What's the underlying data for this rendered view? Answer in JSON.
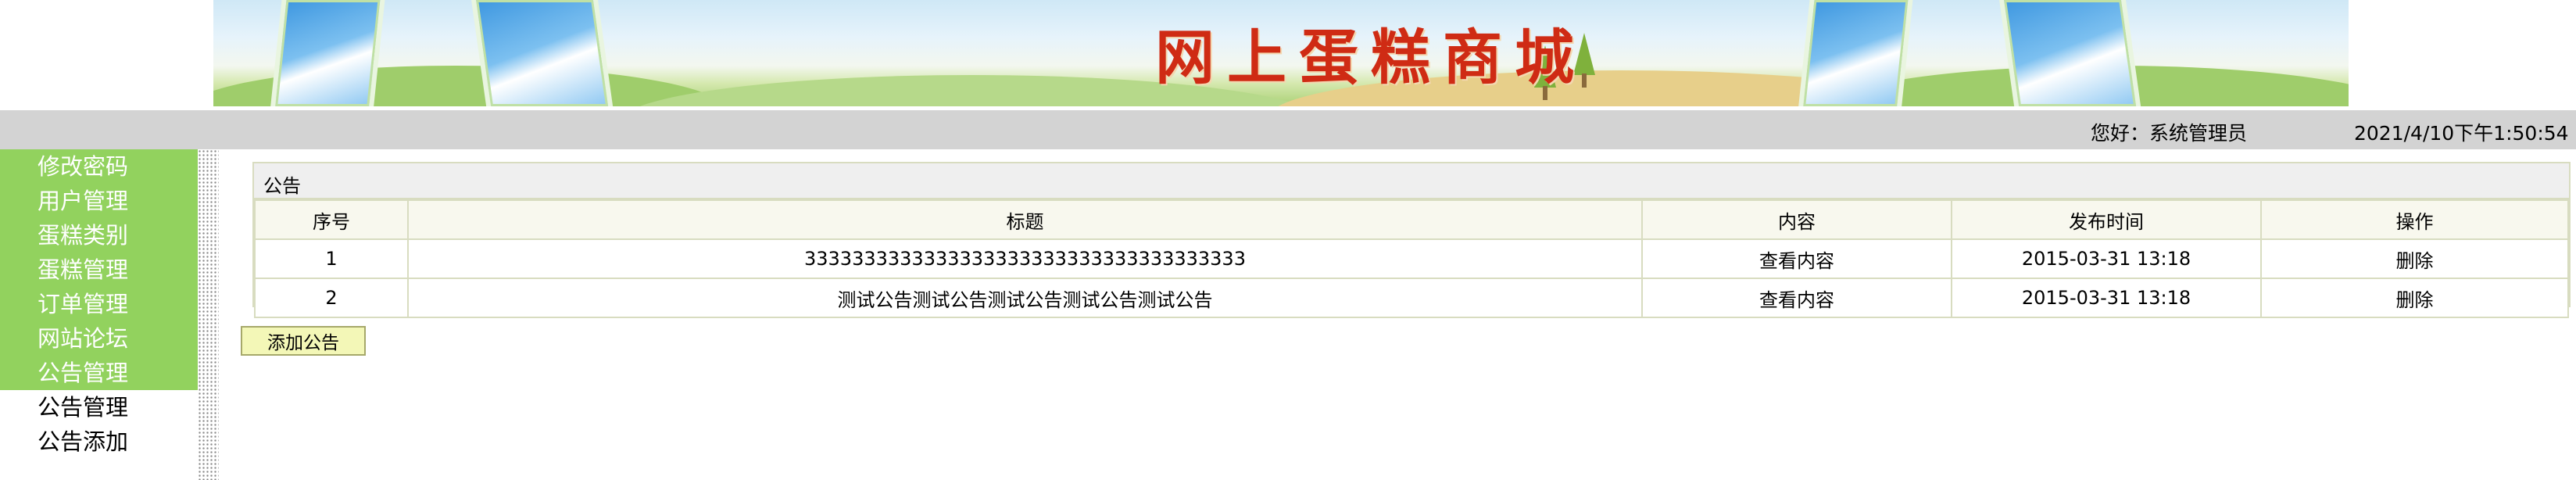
{
  "banner": {
    "title": "网上蛋糕商城"
  },
  "topbar": {
    "greeting": "您好：系统管理员",
    "datetime": "2021/4/10下午1:50:54"
  },
  "sidebar": {
    "items": [
      {
        "label": "修改密码"
      },
      {
        "label": "用户管理"
      },
      {
        "label": "蛋糕类别"
      },
      {
        "label": "蛋糕管理"
      },
      {
        "label": "订单管理"
      },
      {
        "label": "网站论坛"
      },
      {
        "label": "公告管理"
      }
    ],
    "subitems": [
      {
        "label": "公告管理"
      },
      {
        "label": "公告添加"
      }
    ]
  },
  "panel": {
    "title": "公告",
    "columns": [
      "序号",
      "标题",
      "内容",
      "发布时间",
      "操作"
    ],
    "rows": [
      {
        "no": "1",
        "title": "3333333333333333333333333333333333333",
        "content": "查看内容",
        "time": "2015-03-31 13:18",
        "action": "删除"
      },
      {
        "no": "2",
        "title": "测试公告测试公告测试公告测试公告测试公告",
        "content": "查看内容",
        "time": "2015-03-31 13:18",
        "action": "删除"
      }
    ]
  },
  "add_button": {
    "label": "添加公告"
  },
  "colors": {
    "menu_green": "#92d25e",
    "topbar_gray": "#d3d3d3",
    "title_red": "#cf2b14",
    "button_yellow": "#f3f7b7"
  }
}
